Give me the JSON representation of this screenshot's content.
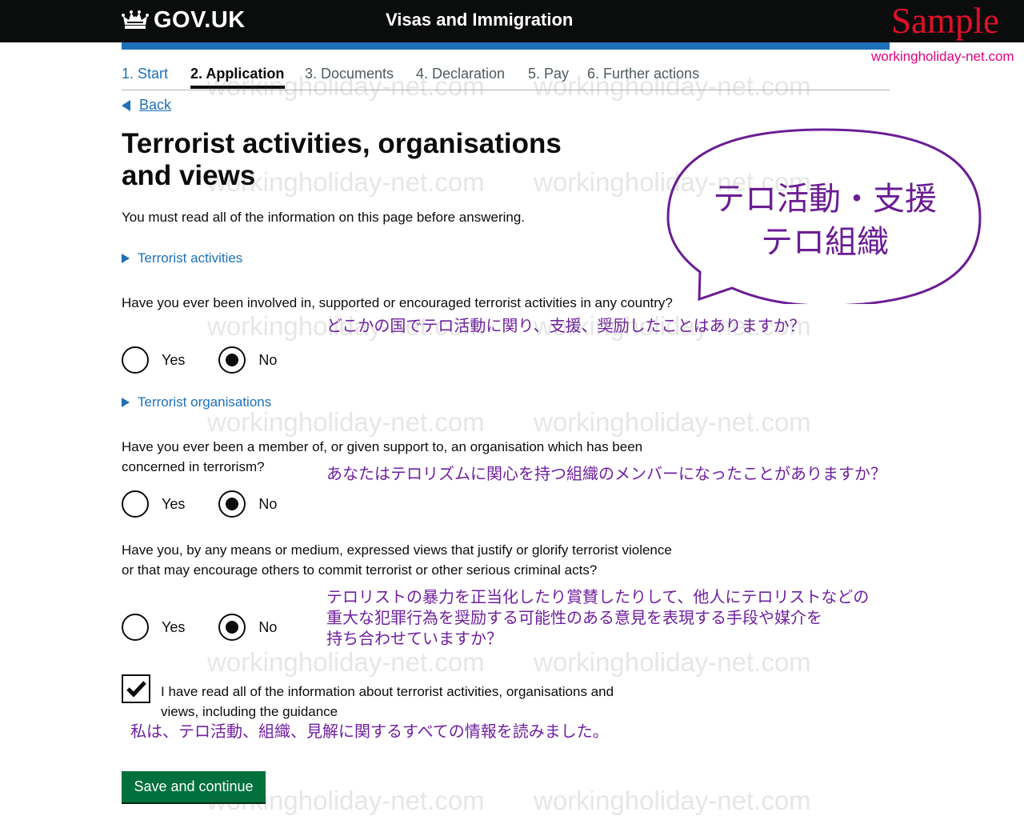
{
  "header": {
    "logo_text": "GOV.UK",
    "service_name": "Visas and Immigration",
    "sample_label": "Sample",
    "sample_site": "workingholiday-net.com"
  },
  "steps": [
    "1. Start",
    "2. Application",
    "3. Documents",
    "4. Declaration",
    "5. Pay",
    "6. Further actions"
  ],
  "current_step": "2. Application",
  "back_link": "Back",
  "page": {
    "title": "Terrorist activities, organisations and views",
    "intro": "You must read all of the information on this page before answering."
  },
  "sections": [
    {
      "details_label": "Terrorist activities",
      "question": "Have you ever been involved in, supported or encouraged terrorist activities in any country?",
      "translation": "どこかの国でテロ活動に関り、支援、奨励したことはありますか？",
      "options": [
        "Yes",
        "No"
      ],
      "selected": "No"
    },
    {
      "details_label": "Terrorist organisations",
      "question": "Have you ever been a member of, or given support to, an organisation which has been concerned in terrorism?",
      "translation": "あなたはテロリズムに関心を持つ組織のメンバーになったことがありますか？",
      "options": [
        "Yes",
        "No"
      ],
      "selected": "No"
    },
    {
      "question": "Have you, by any means or medium, expressed views that justify or glorify terrorist violence or that may encourage others to commit terrorist or other serious criminal acts?",
      "translation_lines": [
        "テロリストの暴力を正当化したり賞賛したりして、他人にテロリストなどの",
        "重大な犯罪行為を奨励する可能性のある意見を表現する手段や媒介を",
        "持ち合わせていますか？"
      ],
      "options": [
        "Yes",
        "No"
      ],
      "selected": "No"
    }
  ],
  "confirmation": {
    "label": "I have read all of the information about terrorist activities, organisations and views, including the guidance",
    "checked": true,
    "translation": "私は、テロ活動、組織、見解に関するすべての情報を読みました。"
  },
  "submit_label": "Save and continue",
  "annotation_bubble": {
    "line1": "テロ活動・支援",
    "line2": "テロ組織"
  },
  "watermark_text": "workingholiday-net.com",
  "colors": {
    "header_bg": "#0b0c0c",
    "govuk_blue": "#1d70b8",
    "button_green": "#00703c",
    "annotation_purple": "#7020a0",
    "sample_red": "#e0102a"
  }
}
